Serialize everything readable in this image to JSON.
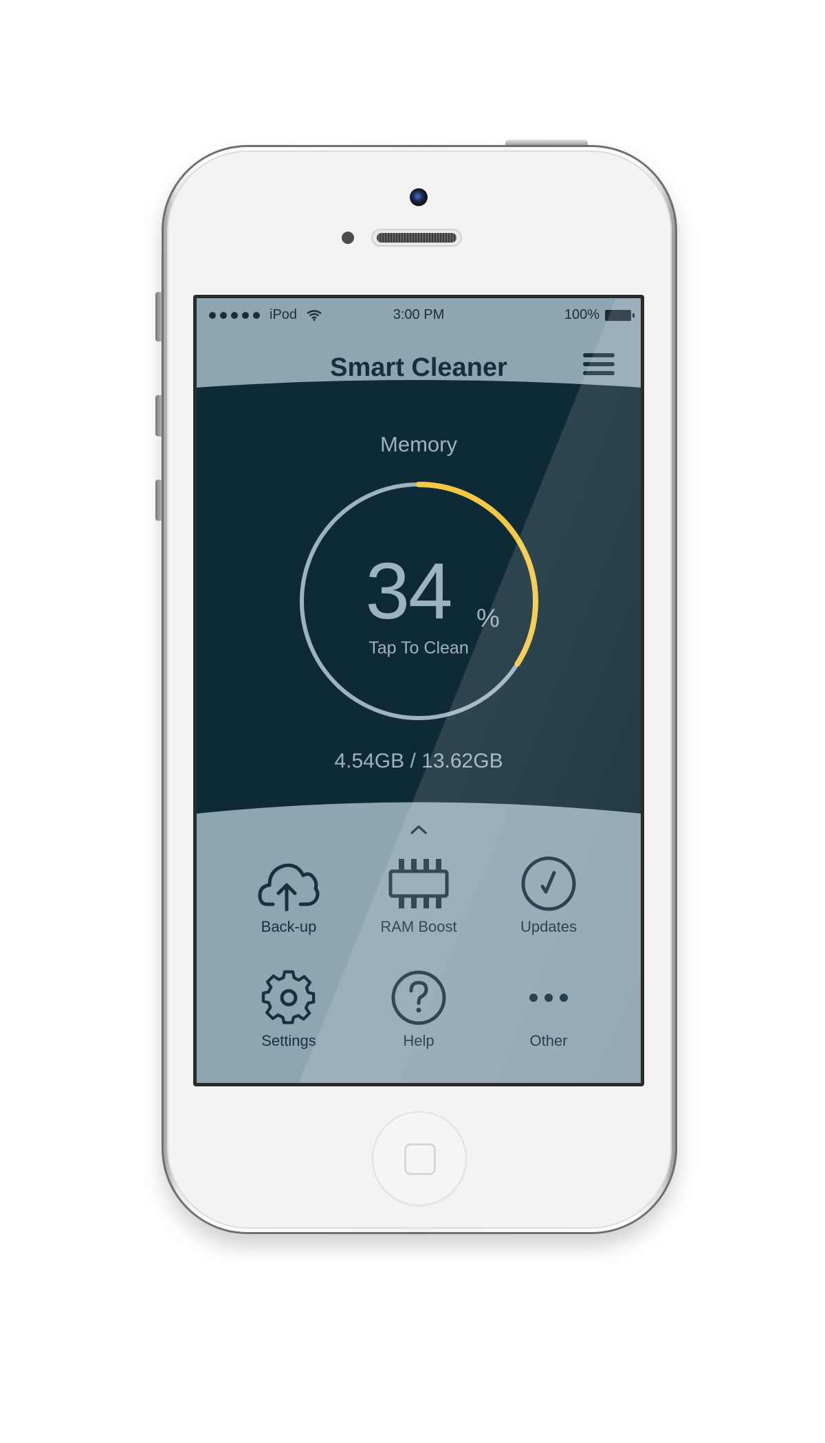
{
  "status_bar": {
    "carrier": "iPod",
    "time": "3:00 PM",
    "battery": "100%"
  },
  "header": {
    "title": "Smart Cleaner"
  },
  "memory": {
    "label": "Memory",
    "percent": "34",
    "percent_sign": "%",
    "action": "Tap To Clean",
    "usage": "4.54GB / 13.62GB",
    "fraction": 0.34
  },
  "grid": [
    {
      "label": "Back-up",
      "icon": "cloud-upload-icon"
    },
    {
      "label": "RAM Boost",
      "icon": "ram-chip-icon"
    },
    {
      "label": "Updates",
      "icon": "check-circle-icon"
    },
    {
      "label": "Settings",
      "icon": "gear-icon"
    },
    {
      "label": "Help",
      "icon": "question-circle-icon"
    },
    {
      "label": "Other",
      "icon": "more-dots-icon"
    }
  ],
  "colors": {
    "accent": "#f5c842",
    "dark_panel": "#0f2a37",
    "light_panel": "#8ea5b2",
    "ring_track": "#9cb3c0",
    "icon_stroke": "#16313f"
  }
}
